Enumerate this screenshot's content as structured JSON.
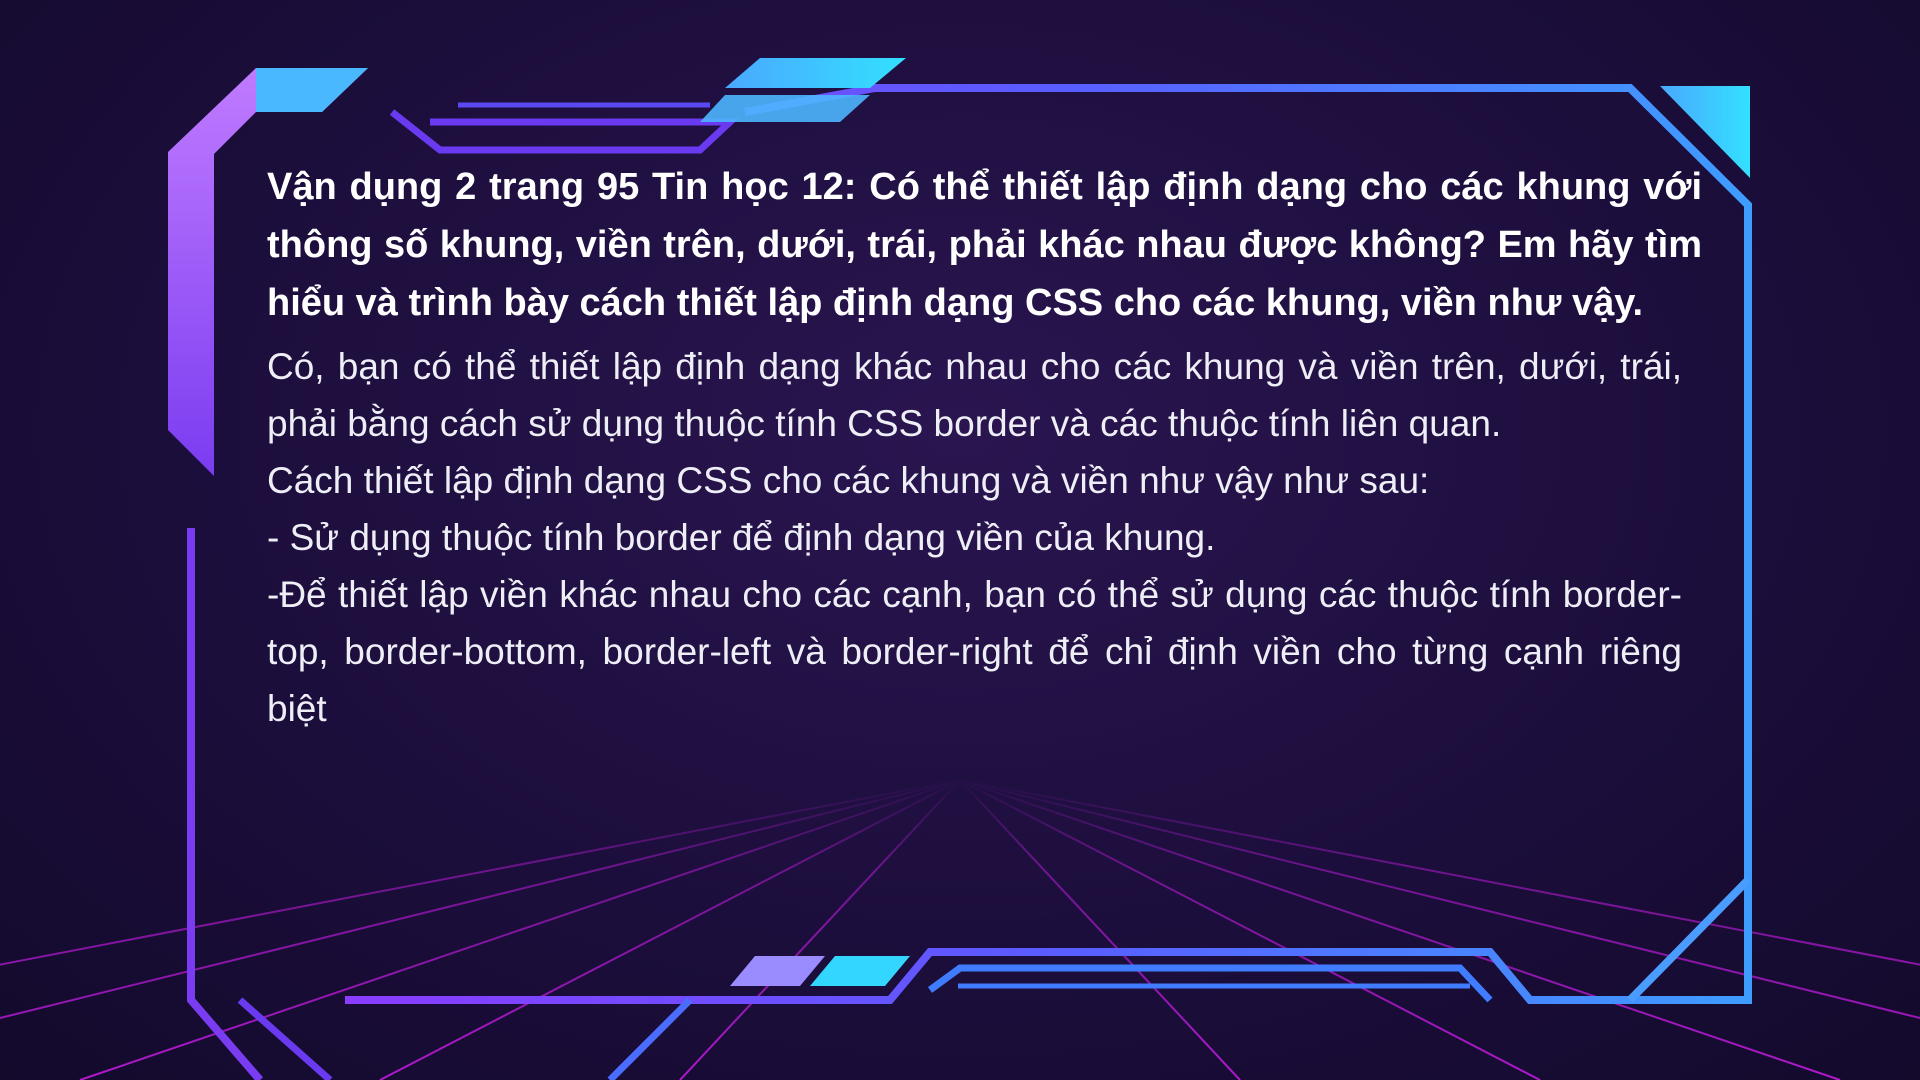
{
  "colors": {
    "background": "#1c0e3c",
    "frame_blue": "#3f7cff",
    "frame_purple": "#8a3cff",
    "accent_cyan": "#33d6ff",
    "grid_magenta": "#b21ad0"
  },
  "question": "Vận dụng 2 trang 95 Tin học 12: Có thể thiết lập định dạng cho các khung với thông số khung, viền trên, dưới, trái, phải khác nhau được không? Em hãy tìm hiểu và trình bày cách thiết lập định dạng CSS cho các khung, viền như vậy.",
  "answer": {
    "intro": "Có, bạn có thể thiết lập định dạng khác nhau cho các khung và viền trên, dưới, trái, phải bằng cách sử dụng thuộc tính CSS border và các thuộc tính liên quan.",
    "method_heading": "Cách thiết lập định dạng CSS cho các khung và viền như vậy như sau:",
    "step_1": "- Sử dụng thuộc tính border để định dạng viền của khung.",
    "step_2": "-Để thiết lập viền khác nhau cho các cạnh, bạn có thể sử dụng các thuộc tính border-top, border-bottom, border-left và border-right để chỉ định viền cho từng cạnh riêng biệt"
  }
}
